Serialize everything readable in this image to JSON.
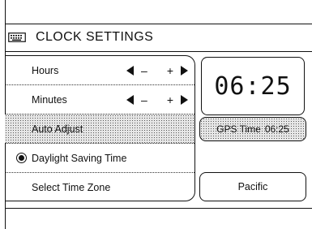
{
  "title": "CLOCK SETTINGS",
  "icons": {
    "title": "keyboard-icon",
    "decrease": "left-triangle-icon",
    "increase": "right-triangle-icon",
    "radio": "radio-selected-icon"
  },
  "settings": {
    "hours": {
      "label": "Hours",
      "minus": "–",
      "plus": "+"
    },
    "minutes": {
      "label": "Minutes",
      "minus": "–",
      "plus": "+"
    },
    "auto_adjust": {
      "label": "Auto Adjust"
    },
    "daylight": {
      "label": "Daylight Saving Time",
      "selected": true
    },
    "time_zone": {
      "label": "Select Time Zone"
    }
  },
  "clock": {
    "time": "06:25"
  },
  "gps": {
    "label": "GPS Time",
    "time": "06:25"
  },
  "zone": {
    "value": "Pacific"
  }
}
